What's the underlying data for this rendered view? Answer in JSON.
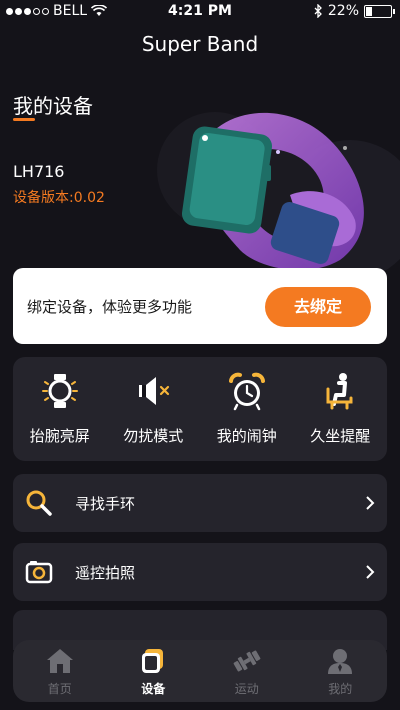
{
  "status_bar": {
    "carrier": "BELL",
    "time": "4:21 PM",
    "battery": "22%",
    "battery_level": 0.22
  },
  "app": {
    "title": "Super Band"
  },
  "device": {
    "section_title": "我的设备",
    "model": "LH716",
    "version": "设备版本:0.02"
  },
  "bind": {
    "text": "绑定设备，体验更多功能",
    "button": "去绑定"
  },
  "functions": [
    {
      "label": "抬腕亮屏",
      "icon": "watch-raise-icon"
    },
    {
      "label": "勿扰模式",
      "icon": "mute-icon"
    },
    {
      "label": "我的闹钟",
      "icon": "alarm-clock-icon"
    },
    {
      "label": "久坐提醒",
      "icon": "sedentary-icon"
    }
  ],
  "rows": [
    {
      "label": "寻找手环",
      "icon": "search-icon"
    },
    {
      "label": "遥控拍照",
      "icon": "camera-icon"
    }
  ],
  "tabs": [
    {
      "label": "首页",
      "icon": "home-icon",
      "active": false
    },
    {
      "label": "设备",
      "icon": "device-icon",
      "active": true
    },
    {
      "label": "运动",
      "icon": "dumbbell-icon",
      "active": false
    },
    {
      "label": "我的",
      "icon": "profile-icon",
      "active": false
    }
  ],
  "colors": {
    "accent": "#f47a21",
    "background": "#141319",
    "card": "#25242c"
  }
}
